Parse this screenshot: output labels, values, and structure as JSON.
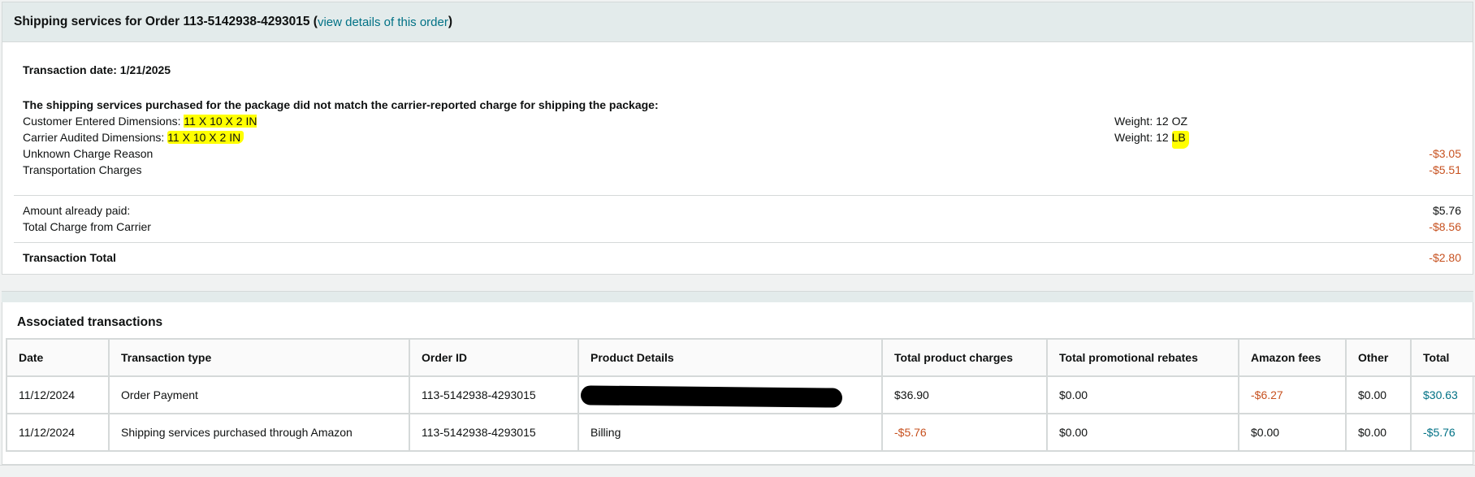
{
  "header": {
    "title_prefix": "Shipping services for Order 113-5142938-4293015 (",
    "link": "view details of this order",
    "title_suffix": ")"
  },
  "transaction_date": "Transaction date: 1/21/2025",
  "mismatch_note": "The shipping services purchased for the package did not match the carrier-reported charge for shipping the package:",
  "dimensions": {
    "customer_label": "Customer Entered Dimensions: ",
    "customer_value": "11 X 10 X 2 IN",
    "carrier_label": "Carrier Audited Dimensions: ",
    "carrier_value": "11 X 10 X 2 IN",
    "weight_customer_prefix": "Weight: 12 ",
    "weight_customer_unit": "OZ",
    "weight_carrier_prefix": "Weight: 12 ",
    "weight_carrier_unit": "LB"
  },
  "charges": [
    {
      "label": "Unknown Charge Reason",
      "amount": "-$3.05"
    },
    {
      "label": "Transportation Charges",
      "amount": "-$5.51"
    }
  ],
  "summary": [
    {
      "label": "Amount already paid:",
      "amount": "$5.76"
    },
    {
      "label": "Total Charge from Carrier",
      "amount": "-$8.56"
    }
  ],
  "total": {
    "label": "Transaction Total",
    "amount": "-$2.80"
  },
  "associated": {
    "title": "Associated transactions",
    "columns": [
      "Date",
      "Transaction type",
      "Order ID",
      "Product Details",
      "Total product charges",
      "Total promotional rebates",
      "Amazon fees",
      "Other",
      "Total"
    ],
    "rows": [
      [
        "11/12/2024",
        "Order Payment",
        "113-5142938-4293015",
        "",
        "$36.90",
        "$0.00",
        "-$6.27",
        "$0.00",
        "$30.63"
      ],
      [
        "11/12/2024",
        "Shipping services purchased through Amazon",
        "113-5142938-4293015",
        "Billing",
        "-$5.76",
        "$0.00",
        "$0.00",
        "$0.00",
        "-$5.76"
      ]
    ]
  },
  "colors": {
    "accent": "#007185",
    "negative": "#c7511f",
    "highlight": "#ffff00",
    "header_bg": "#e3ebeb"
  }
}
